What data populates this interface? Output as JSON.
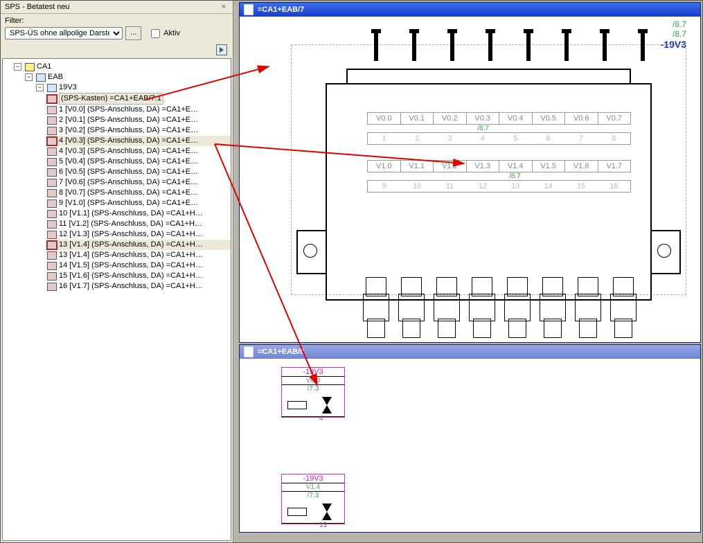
{
  "panel": {
    "title": "SPS - Betatest neu",
    "filter_label": "Filter:",
    "filter_value": "SPS-ÜS ohne allpolige Darstellung",
    "btn_more": "...",
    "chk_active": "Aktiv"
  },
  "tree": {
    "root": "CA1",
    "n1": "EAB",
    "n2": "19V3",
    "sel": "(SPS-Kasten) =CA1+EAB/7.1",
    "items": [
      "1  [V0.0] (SPS-Anschluss, DA) =CA1+E…",
      "2  [V0.1] (SPS-Anschluss, DA) =CA1+E…",
      "3  [V0.2] (SPS-Anschluss, DA) =CA1+E…",
      "4  [V0.3] (SPS-Anschluss, DA) =CA1+E…",
      "4  [V0.3] (SPS-Anschluss, DA) =CA1+E…",
      "5  [V0.4] (SPS-Anschluss, DA) =CA1+E…",
      "6  [V0.5] (SPS-Anschluss, DA) =CA1+E…",
      "7  [V0.6] (SPS-Anschluss, DA) =CA1+E…",
      "8  [V0.7] (SPS-Anschluss, DA) =CA1+E…",
      "9  [V1.0] (SPS-Anschluss, DA) =CA1+E…",
      "10 [V1.1] (SPS-Anschluss, DA) =CA1+H…",
      "11 [V1.2] (SPS-Anschluss, DA) =CA1+H…",
      "12 [V1.3] (SPS-Anschluss, DA) =CA1+H…",
      "13 [V1.4] (SPS-Anschluss, DA) =CA1+H…",
      "13 [V1.4] (SPS-Anschluss, DA) =CA1+H…",
      "14 [V1.5] (SPS-Anschluss, DA) =CA1+H…",
      "15 [V1.6] (SPS-Anschluss, DA) =CA1+H…",
      "16 [V1.7] (SPS-Anschluss, DA) =CA1+H…"
    ]
  },
  "doc1": {
    "title": "=CA1+EAB/7",
    "corner1": "/8.7",
    "corner2": "/8.7",
    "corner3": "-19V3",
    "row1": [
      "V0.0",
      "V0.1",
      "V0.2",
      "V0.3",
      "V0.4",
      "V0.5",
      "V0.6",
      "V0.7"
    ],
    "row1_anno": "/8.7",
    "row1_nums": [
      "1",
      "2",
      "3",
      "4",
      "5",
      "6",
      "7",
      "8"
    ],
    "row2": [
      "V1.0",
      "V1.1",
      "V1.2",
      "V1.3",
      "V1.4",
      "V1.5",
      "V1.6",
      "V1.7"
    ],
    "row2_anno": "/8.7",
    "row2_nums": [
      "9",
      "10",
      "11",
      "12",
      "13",
      "14",
      "15",
      "16"
    ]
  },
  "doc2": {
    "title": "=CA1+EAB/8",
    "sym1": {
      "t": "-19V3",
      "s": "V0.3",
      "a": "/7.3",
      "pin": "4"
    },
    "sym2": {
      "t": "-19V3",
      "s": "V1.4",
      "a": "/7.3",
      "pin": "13"
    }
  }
}
